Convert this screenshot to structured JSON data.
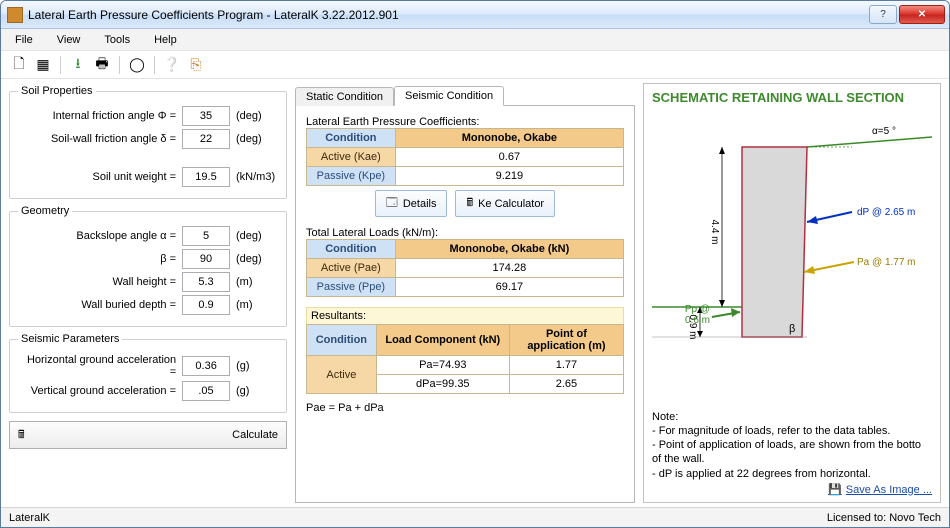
{
  "window": {
    "title": "Lateral Earth Pressure Coefficients Program - LateralK 3.22.2012.901"
  },
  "menu": {
    "file": "File",
    "view": "View",
    "tools": "Tools",
    "help": "Help"
  },
  "soil": {
    "legend": "Soil Properties",
    "phi_label": "Internal friction angle  Φ =",
    "phi": "35",
    "phi_unit": "(deg)",
    "delta_label": "Soil-wall friction angle  δ =",
    "delta": "22",
    "delta_unit": "(deg)",
    "gamma_label": "Soil unit weight =",
    "gamma": "19.5",
    "gamma_unit": "(kN/m3)"
  },
  "geometry": {
    "legend": "Geometry",
    "alpha_label": "Backslope angle  α =",
    "alpha": "5",
    "alpha_unit": "(deg)",
    "beta_label": "β =",
    "beta": "90",
    "beta_unit": "(deg)",
    "h_label": "Wall height =",
    "h": "5.3",
    "h_unit": "(m)",
    "d_label": "Wall buried depth =",
    "d": "0.9",
    "d_unit": "(m)"
  },
  "seismic": {
    "legend": "Seismic Parameters",
    "kh_label": "Horizontal ground acceleration =",
    "kh": "0.36",
    "kh_unit": "(g)",
    "kv_label": "Vertical ground acceleration =",
    "kv": ".05",
    "kv_unit": "(g)"
  },
  "calc_label": "Calculate",
  "tabs": {
    "static": "Static Condition",
    "seismic": "Seismic Condition"
  },
  "coeffs": {
    "title": "Lateral Earth Pressure Coefficients:",
    "cond": "Condition",
    "method": "Mononobe, Okabe",
    "kae_lbl": "Active (Kae)",
    "kae": "0.67",
    "kpe_lbl": "Passive (Kpe)",
    "kpe": "9.219",
    "details": "Details",
    "kecalc": "Ke Calculator"
  },
  "loads": {
    "title": "Total Lateral Loads (kN/m):",
    "cond": "Condition",
    "method": "Mononobe, Okabe (kN)",
    "pae_lbl": "Active (Pae)",
    "pae": "174.28",
    "ppe_lbl": "Passive (Ppe)",
    "ppe": "69.17"
  },
  "resultants": {
    "title": "Resultants:",
    "cond": "Condition",
    "comp": "Load Component (kN)",
    "poa": "Point of application (m)",
    "active": "Active",
    "pa": "Pa=74.93",
    "pa_h": "1.77",
    "dpa": "dPa=99.35",
    "dpa_h": "2.65",
    "footnote": "Pae = Pa + dPa"
  },
  "schematic": {
    "title": "SCHEMATIC RETAINING WALL SECTION",
    "alpha": "α=5 °",
    "h44": "4.4 m",
    "d09": "0.9 m",
    "dp": "dP @ 2.65 m",
    "pa": "Pa @ 1.77 m",
    "pp": "Pp @",
    "pp2": "0.6 m",
    "beta": "β",
    "note_title": "Note:",
    "note1": "- For magnitude of loads, refer to the data tables.",
    "note2": "- Point of application of loads, are shown from the botto of the wall.",
    "note3": "- dP is applied at 22 degrees from horizontal.",
    "save": "Save As Image ..."
  },
  "status": {
    "left": "LateralK",
    "right": "Licensed to: Novo Tech"
  }
}
